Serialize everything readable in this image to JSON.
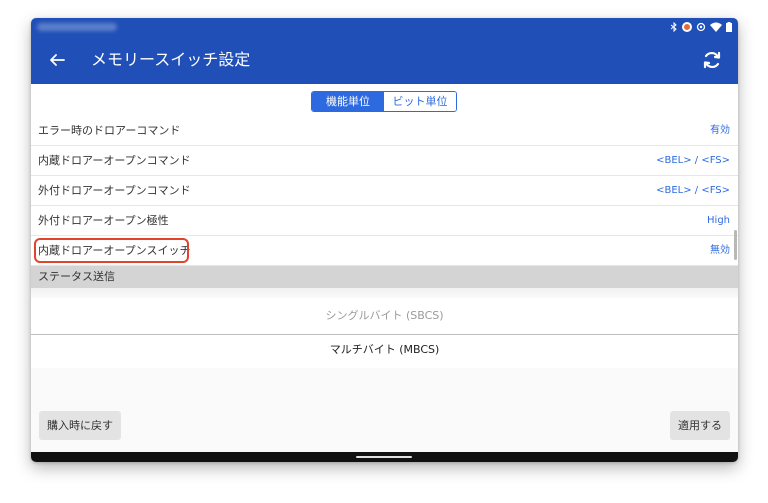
{
  "window": {
    "title": "メモリースイッチ設定"
  },
  "tabs": [
    {
      "label": "機能単位",
      "active": true
    },
    {
      "label": "ビット単位",
      "active": false
    }
  ],
  "settings": [
    {
      "label": "エラー時のドロアーコマンド",
      "value": "有効"
    },
    {
      "label": "内蔵ドロアーオープンコマンド",
      "value": "<BEL> / <FS>"
    },
    {
      "label": "外付ドロアーオープンコマンド",
      "value": "<BEL> / <FS>"
    },
    {
      "label": "外付ドロアーオープン極性",
      "value": "High"
    },
    {
      "label": "内蔵ドロアーオープンスイッチ",
      "value": "無効",
      "highlighted": true
    }
  ],
  "section": {
    "label": "ステータス送信"
  },
  "picker": {
    "options": [
      {
        "label": "シングルバイト (SBCS)",
        "selected": false
      },
      {
        "label": "マルチバイト (MBCS)",
        "selected": true
      }
    ]
  },
  "buttons": {
    "reset": "購入時に戻す",
    "apply": "適用する"
  },
  "icons": {
    "back": "arrow-back-icon",
    "refresh": "refresh-icon"
  },
  "colors": {
    "app_bar": "#1f4fb7",
    "accent": "#2d6ae0",
    "highlight": "#e0442b"
  }
}
